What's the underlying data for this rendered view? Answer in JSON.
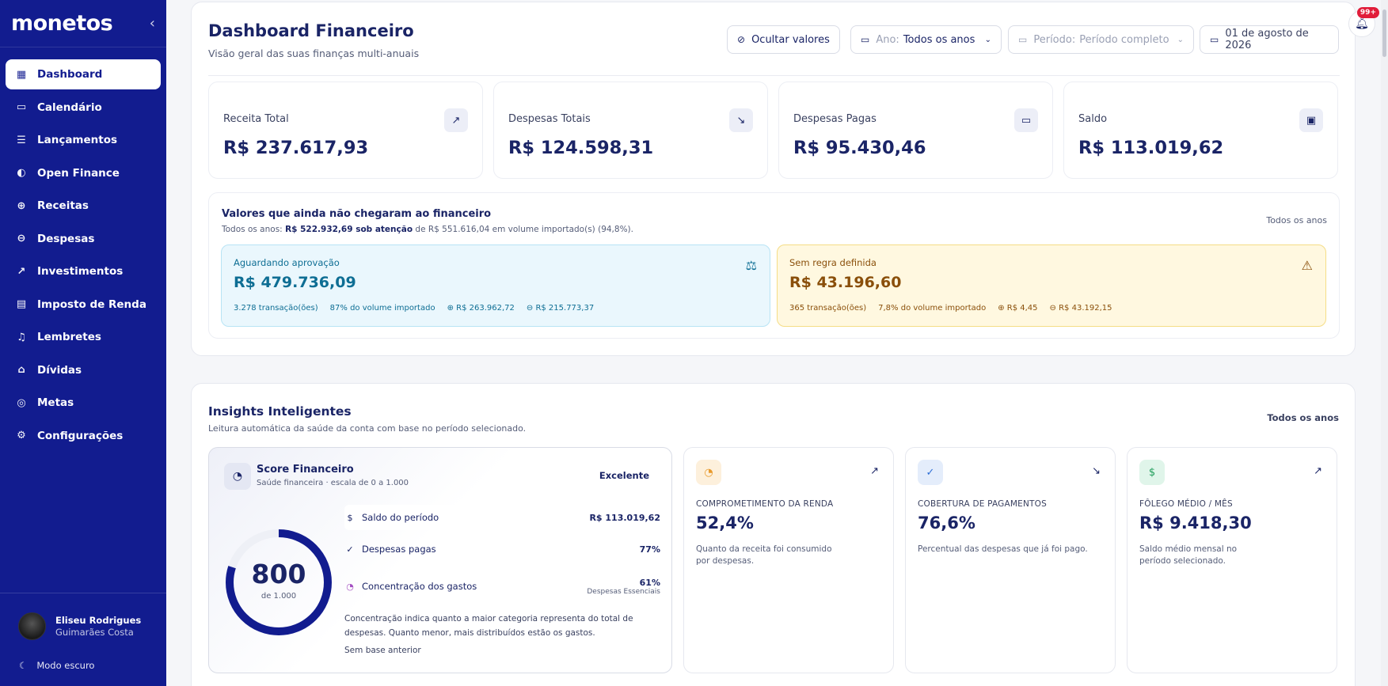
{
  "app": {
    "logo": "monetos",
    "collapse_icon": "chevron-left-icon"
  },
  "sidebar": {
    "items": [
      {
        "label": "Dashboard",
        "icon": "grid-icon",
        "active": true
      },
      {
        "label": "Calendário",
        "icon": "calendar-icon"
      },
      {
        "label": "Lançamentos",
        "icon": "list-icon"
      },
      {
        "label": "Open Finance",
        "icon": "link-icon"
      },
      {
        "label": "Receitas",
        "icon": "arrow-up-circle-icon"
      },
      {
        "label": "Despesas",
        "icon": "arrow-down-circle-icon"
      },
      {
        "label": "Investimentos",
        "icon": "chart-line-icon"
      },
      {
        "label": "Imposto de Renda",
        "icon": "document-icon"
      },
      {
        "label": "Lembretes",
        "icon": "bell-icon"
      },
      {
        "label": "Dívidas",
        "icon": "bank-icon"
      },
      {
        "label": "Metas",
        "icon": "target-icon"
      },
      {
        "label": "Configurações",
        "icon": "gear-icon"
      }
    ],
    "user": {
      "name": "Eliseu Rodrigues",
      "surname": "Guimarães Costa"
    },
    "dark_mode_label": "Modo escuro"
  },
  "header": {
    "title": "Dashboard Financeiro",
    "subtitle": "Visão geral das suas finanças multi-anuais",
    "hide_values_label": "Ocultar valores",
    "year_prefix": "Ano:",
    "year_value": "Todos os anos",
    "period_prefix": "Período:",
    "period_value": "Período completo",
    "date_label": "01 de agosto de 2026",
    "notifications_count": "99+"
  },
  "kpis": [
    {
      "label": "Receita Total",
      "value": "R$ 237.617,93",
      "icon": "trend-up-icon"
    },
    {
      "label": "Despesas Totais",
      "value": "R$ 124.598,31",
      "icon": "trend-down-icon"
    },
    {
      "label": "Despesas Pagas",
      "value": "R$ 95.430,46",
      "icon": "card-icon"
    },
    {
      "label": "Saldo",
      "value": "R$ 113.019,62",
      "icon": "wallet-icon"
    }
  ],
  "pending": {
    "title": "Valores que ainda não chegaram ao financeiro",
    "desc_prefix": "Todos os anos:",
    "desc_bold": "R$ 522.932,69 sob atenção",
    "desc_suffix": "de R$ 551.616,04 em volume importado(s) (94,8%).",
    "year": "Todos os anos",
    "awaiting": {
      "label": "Aguardando aprovação",
      "value": "R$ 479.736,09",
      "transactions": "3.278 transação(ões)",
      "share": "87% do volume importado",
      "in": "R$ 263.962,72",
      "out": "R$ 215.773,37"
    },
    "norule": {
      "label": "Sem regra definida",
      "value": "R$ 43.196,60",
      "transactions": "365 transação(ões)",
      "share": "7,8% do volume importado",
      "in": "R$ 4,45",
      "out": "R$ 43.192,15"
    }
  },
  "insights": {
    "title": "Insights Inteligentes",
    "subtitle": "Leitura automática da saúde da conta com base no período selecionado.",
    "year": "Todos os anos",
    "score": {
      "title": "Score Financeiro",
      "subtitle": "Saúde financeira · escala de 0 a 1.000",
      "badge": "Excelente",
      "value": "800",
      "of": "de 1.000",
      "fraction": 0.8,
      "metrics": [
        {
          "label": "Saldo do período",
          "value": "R$ 113.019,62",
          "sub": ""
        },
        {
          "label": "Despesas pagas",
          "value": "77%",
          "sub": ""
        },
        {
          "label": "Concentração dos gastos",
          "value": "61%",
          "sub": "Despesas Essenciais"
        }
      ],
      "note": "Concentração indica quanto a maior categoria representa do total de despesas. Quanto menor, mais distribuídos estão os gastos.",
      "nobase": "Sem base anterior"
    },
    "cards": [
      {
        "label": "COMPROMETIMENTO DA RENDA",
        "value": "52,4%",
        "desc": "Quanto da receita foi consumido por despesas.",
        "icon": "pie-icon",
        "trend": "trend-up-icon",
        "accent": "#e89a2c",
        "accent_bg": "#fdf0dc"
      },
      {
        "label": "COBERTURA DE PAGAMENTOS",
        "value": "76,6%",
        "desc": "Percentual das despesas que já foi pago.",
        "icon": "check-circle-icon",
        "trend": "trend-down-icon",
        "accent": "#2f6fd6",
        "accent_bg": "#e4edfb"
      },
      {
        "label": "FÔLEGO MÉDIO / MÊS",
        "value": "R$ 9.418,30",
        "desc": "Saldo médio mensal no período selecionado.",
        "icon": "dollar-icon",
        "trend": "trend-up-icon",
        "accent": "#1f9d5a",
        "accent_bg": "#e0f5ea"
      }
    ]
  }
}
